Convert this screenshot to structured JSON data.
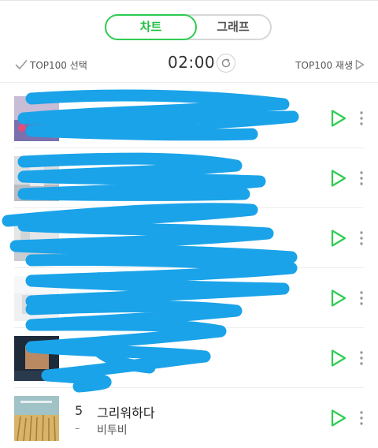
{
  "tabs": {
    "chart": "차트",
    "graph": "그래프"
  },
  "controls": {
    "select_top100": "TOP100 선택",
    "timer": "02:00",
    "play_top100": "TOP100 재생"
  },
  "list": [
    {
      "rank": "",
      "dash": "",
      "title": "",
      "artist": ""
    },
    {
      "rank": "",
      "dash": "",
      "title": "",
      "artist": ""
    },
    {
      "rank": "",
      "dash": "",
      "title": "",
      "artist": ""
    },
    {
      "rank": "",
      "dash": "",
      "title": "",
      "artist": ""
    },
    {
      "rank": "",
      "dash": "",
      "title": "",
      "artist": ""
    },
    {
      "rank": "5",
      "dash": "–",
      "title": "그리워하다",
      "artist": "비투비"
    }
  ],
  "colors": {
    "accent": "#2ecc52",
    "scribble": "#1aa3e8"
  },
  "icons": {
    "select": "check-icon",
    "refresh": "refresh-icon",
    "play_all": "play-icon",
    "row_play": "play-icon",
    "row_more": "more-vertical-icon"
  }
}
